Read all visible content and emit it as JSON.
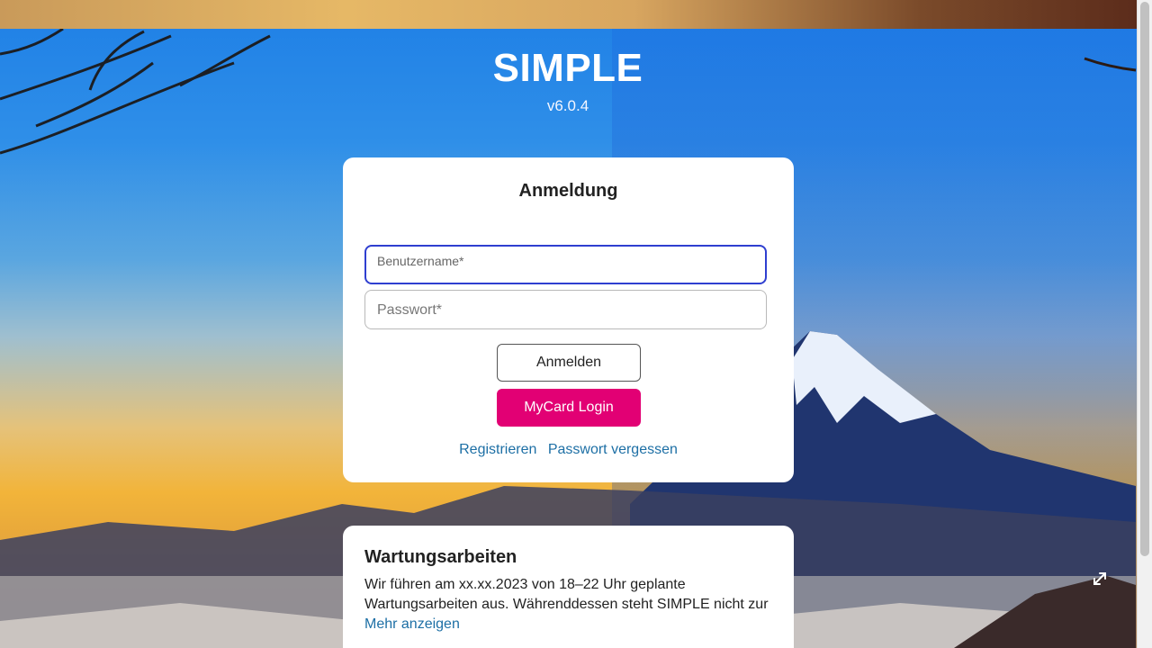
{
  "app": {
    "title": "SIMPLE",
    "version": "v6.0.4"
  },
  "login": {
    "heading": "Anmeldung",
    "username_placeholder": "Benutzername*",
    "password_placeholder": "Passwort*",
    "login_button": "Anmelden",
    "mycard_button": "MyCard Login",
    "register_link": "Registrieren",
    "forgot_link": "Passwort vergessen"
  },
  "notice": {
    "heading": "Wartungsarbeiten",
    "text": "Wir führen am xx.xx.2023 von 18–22 Uhr geplante Wartungsarbeiten aus. Währenddessen steht SIMPLE nicht zur",
    "more_link": "Mehr anzeigen"
  },
  "icons": {
    "expand": "expand-icon"
  },
  "colors": {
    "accent": "#e20074",
    "focus": "#2f3fd0",
    "link": "#1d6fa5"
  }
}
